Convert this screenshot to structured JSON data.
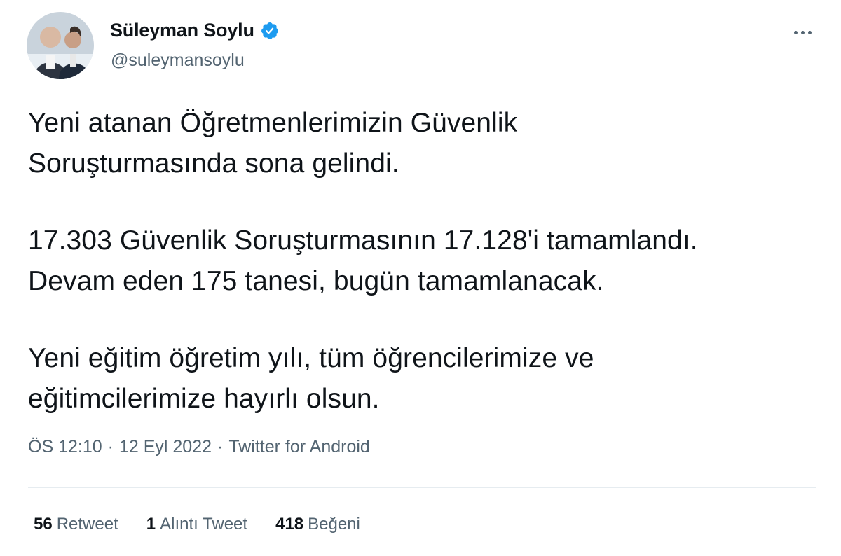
{
  "author": {
    "display_name": "Süleyman Soylu",
    "handle": "@suleymansoylu",
    "verified_icon": "verified-badge-icon",
    "verified_color": "#1d9bf0"
  },
  "tweet": {
    "paragraphs": [
      [
        "Yeni atanan Öğretmenlerimizin Güvenlik",
        "Soruşturmasında sona gelindi."
      ],
      [
        "17.303 Güvenlik Soruşturmasının 17.128'i tamamlandı.",
        "Devam eden 175 tanesi, bugün tamamlanacak."
      ],
      [
        "Yeni eğitim öğretim yılı, tüm öğrencilerimize ve",
        "eğitimcilerimize hayırlı olsun."
      ]
    ]
  },
  "meta": {
    "time": "ÖS 12:10",
    "separator": "·",
    "date": "12 Eyl 2022",
    "source": "Twitter for Android"
  },
  "stats": {
    "retweets": {
      "count": "56",
      "label": "Retweet"
    },
    "quotes": {
      "count": "1",
      "label": "Alıntı Tweet"
    },
    "likes": {
      "count": "418",
      "label": "Beğeni"
    }
  },
  "colors": {
    "text": "#0f1419",
    "secondary": "#536471",
    "divider": "#e6ecf0"
  }
}
